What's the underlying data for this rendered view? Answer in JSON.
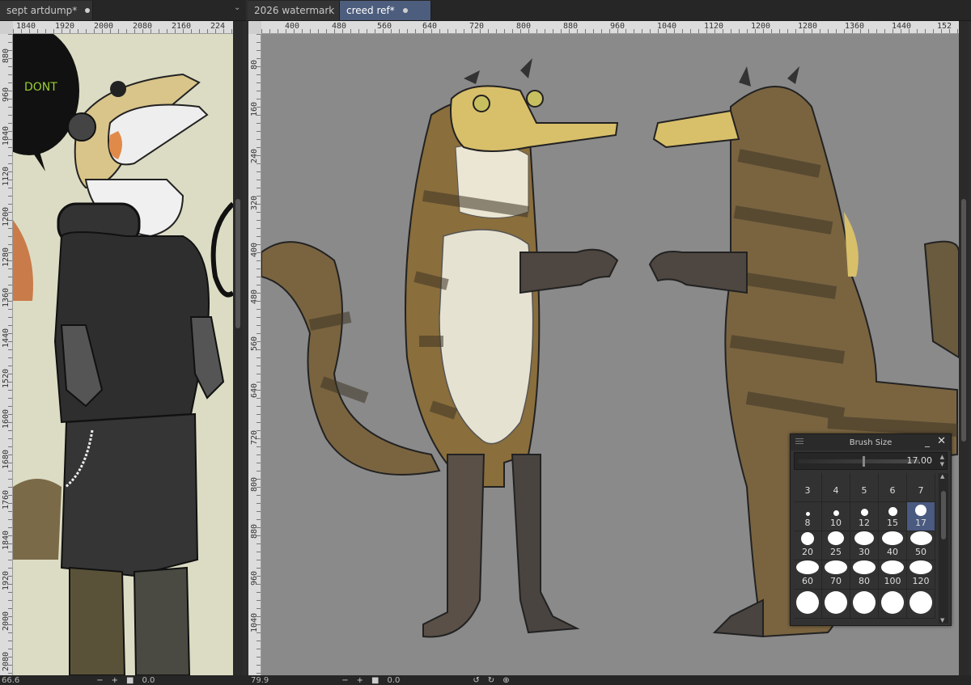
{
  "left_view": {
    "tab": {
      "label": "sept artdump*"
    },
    "ruler_h": [
      "1840",
      "1920",
      "2000",
      "2080",
      "2160",
      "224"
    ],
    "ruler_v": [
      "880",
      "960",
      "1040",
      "1120",
      "1200",
      "1280",
      "1360",
      "1440",
      "1520",
      "1600",
      "1680",
      "1760",
      "1840",
      "1920",
      "2000",
      "2080"
    ],
    "canvas_text": "DONT",
    "status": {
      "zoom": "66.6",
      "minus": "−",
      "plus": "+",
      "stop": "■",
      "angle": "0.0"
    }
  },
  "right_view": {
    "tabs": [
      {
        "label": "2026 watermark",
        "active": false
      },
      {
        "label": "creed ref*",
        "active": true
      }
    ],
    "ruler_h": [
      "400",
      "480",
      "560",
      "640",
      "720",
      "800",
      "880",
      "960",
      "1040",
      "1120",
      "1200",
      "1280",
      "1360",
      "1440",
      "152"
    ],
    "ruler_v": [
      "80",
      "160",
      "240",
      "320",
      "400",
      "480",
      "560",
      "640",
      "720",
      "800",
      "880",
      "960",
      "1040"
    ],
    "status": {
      "zoom": "79.9",
      "minus": "−",
      "plus": "+",
      "stop": "■",
      "angle": "0.0",
      "rotate_ccw": "↺",
      "rotate_cw": "↻",
      "reset": "⊕"
    }
  },
  "brush_docker": {
    "title": "Brush Size",
    "value": "17.00",
    "value_fraction": 0.17,
    "presets": [
      {
        "label": "3",
        "d": 0
      },
      {
        "label": "4",
        "d": 0
      },
      {
        "label": "5",
        "d": 0
      },
      {
        "label": "6",
        "d": 0
      },
      {
        "label": "7",
        "d": 0
      },
      {
        "label": "8",
        "d": 5
      },
      {
        "label": "10",
        "d": 7
      },
      {
        "label": "12",
        "d": 9
      },
      {
        "label": "15",
        "d": 11
      },
      {
        "label": "17",
        "d": 14,
        "selected": true
      },
      {
        "label": "20",
        "d": 16
      },
      {
        "label": "25",
        "d": 20
      },
      {
        "label": "30",
        "d": 24
      },
      {
        "label": "40",
        "d": 26
      },
      {
        "label": "50",
        "d": 27
      },
      {
        "label": "60",
        "d": 28
      },
      {
        "label": "70",
        "d": 28
      },
      {
        "label": "80",
        "d": 28
      },
      {
        "label": "100",
        "d": 28
      },
      {
        "label": "120",
        "d": 28
      },
      {
        "label": "",
        "d": 28
      },
      {
        "label": "",
        "d": 28
      },
      {
        "label": "",
        "d": 28
      },
      {
        "label": "",
        "d": 28
      },
      {
        "label": "",
        "d": 28
      }
    ]
  },
  "colors": {
    "canvas_left_bg": "#dcdcc4",
    "canvas_right_bg": "#8a8a8a",
    "active_tab": "#4d5d7d",
    "selected_preset": "#4a5a80"
  }
}
